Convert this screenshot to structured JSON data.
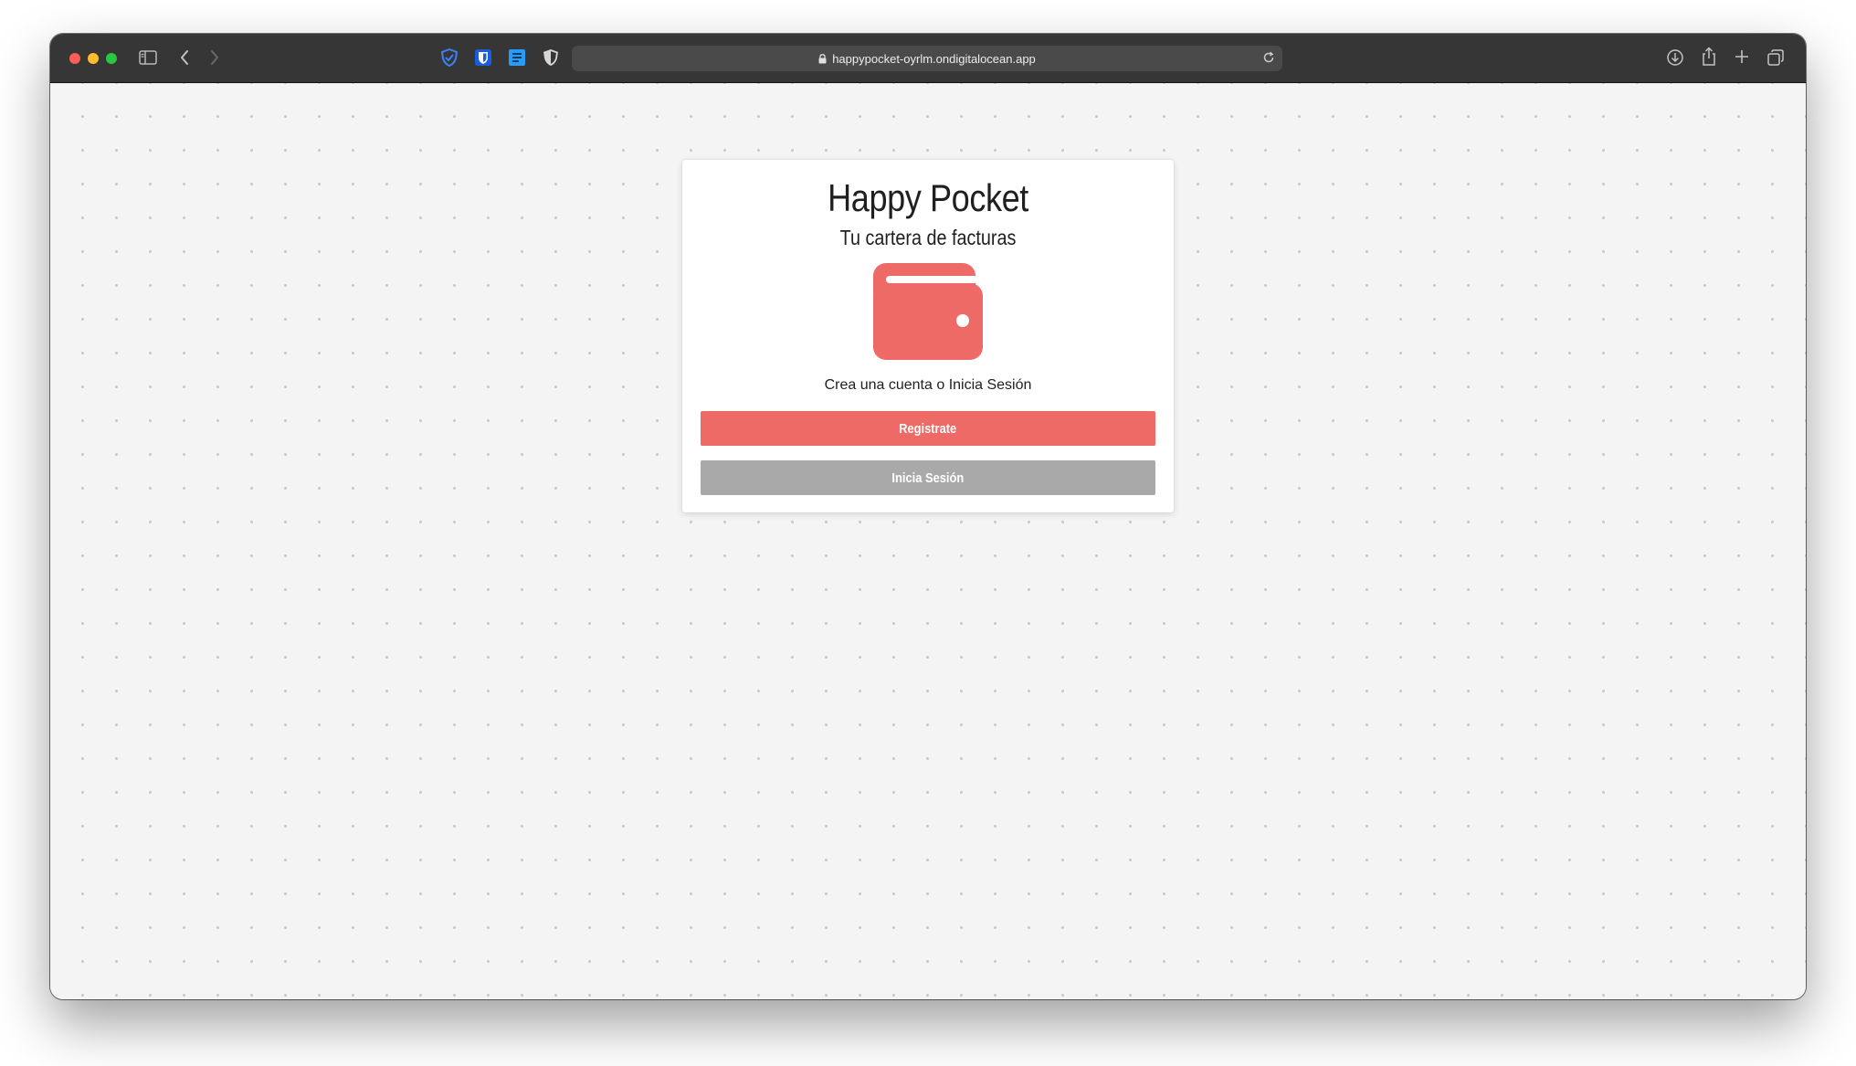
{
  "browser": {
    "url": "happypocket-oyrlm.ondigitalocean.app",
    "colors": {
      "toolbar": "#363636",
      "urlbar": "#4a4a4a"
    }
  },
  "app": {
    "title": "Happy Pocket",
    "subtitle": "Tu cartera de facturas",
    "icon": "wallet-icon",
    "prompt": "Crea una cuenta o Inicia Sesión",
    "register_label": "Registrate",
    "login_label": "Inicia Sesión",
    "colors": {
      "accent": "#ee6a67",
      "secondary": "#a9a9a9"
    }
  }
}
